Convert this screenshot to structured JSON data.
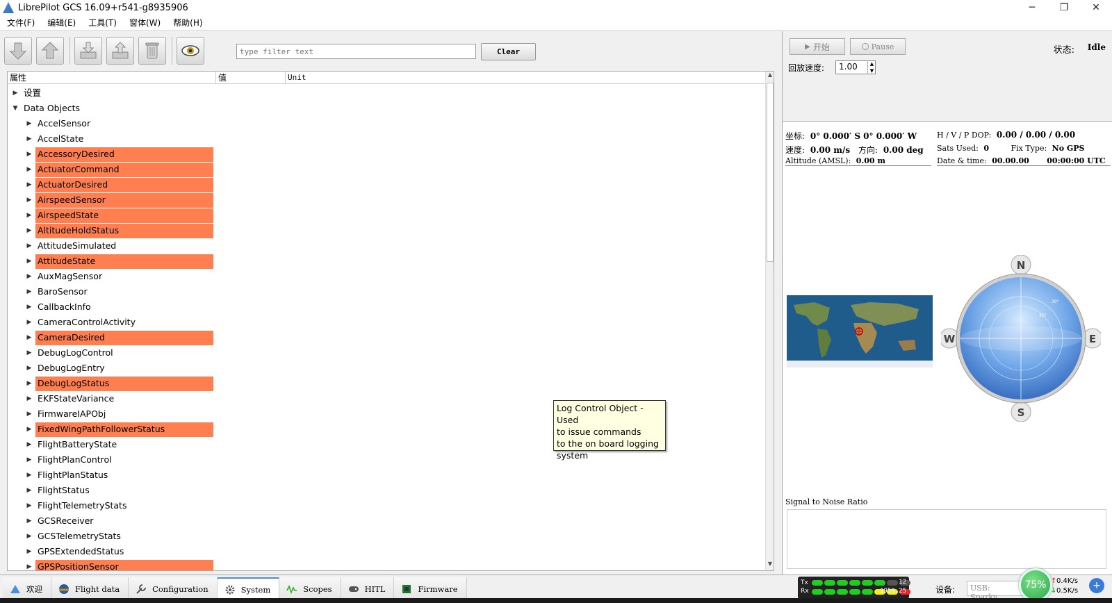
{
  "window": {
    "title": "LibrePilot GCS 16.09+r541-g8935906",
    "minimize": "─",
    "maximize": "❐",
    "close": "✕"
  },
  "menu": [
    "文件(F)",
    "编辑(E)",
    "工具(T)",
    "窗体(W)",
    "帮助(H)"
  ],
  "toolbar": {
    "filter_placeholder": "type filter text",
    "clear_label": "Clear"
  },
  "tree": {
    "headers": {
      "property": "属性",
      "value": "值",
      "unit": "Unit"
    },
    "rows": [
      {
        "label": "设置",
        "level": 0,
        "expanded": false,
        "highlight": false
      },
      {
        "label": "Data Objects",
        "level": 0,
        "expanded": true,
        "highlight": false
      },
      {
        "label": "AccelSensor",
        "level": 1,
        "highlight": false
      },
      {
        "label": "AccelState",
        "level": 1,
        "highlight": false
      },
      {
        "label": "AccessoryDesired",
        "level": 1,
        "highlight": true
      },
      {
        "label": "ActuatorCommand",
        "level": 1,
        "highlight": true
      },
      {
        "label": "ActuatorDesired",
        "level": 1,
        "highlight": true
      },
      {
        "label": "AirspeedSensor",
        "level": 1,
        "highlight": true
      },
      {
        "label": "AirspeedState",
        "level": 1,
        "highlight": true
      },
      {
        "label": "AltitudeHoldStatus",
        "level": 1,
        "highlight": true
      },
      {
        "label": "AttitudeSimulated",
        "level": 1,
        "highlight": false
      },
      {
        "label": "AttitudeState",
        "level": 1,
        "highlight": true
      },
      {
        "label": "AuxMagSensor",
        "level": 1,
        "highlight": false
      },
      {
        "label": "BaroSensor",
        "level": 1,
        "highlight": false
      },
      {
        "label": "CallbackInfo",
        "level": 1,
        "highlight": false
      },
      {
        "label": "CameraControlActivity",
        "level": 1,
        "highlight": false
      },
      {
        "label": "CameraDesired",
        "level": 1,
        "highlight": true
      },
      {
        "label": "DebugLogControl",
        "level": 1,
        "highlight": false
      },
      {
        "label": "DebugLogEntry",
        "level": 1,
        "highlight": false
      },
      {
        "label": "DebugLogStatus",
        "level": 1,
        "highlight": true
      },
      {
        "label": "EKFStateVariance",
        "level": 1,
        "highlight": false
      },
      {
        "label": "FirmwareIAPObj",
        "level": 1,
        "highlight": false
      },
      {
        "label": "FixedWingPathFollowerStatus",
        "level": 1,
        "highlight": true
      },
      {
        "label": "FlightBatteryState",
        "level": 1,
        "highlight": false
      },
      {
        "label": "FlightPlanControl",
        "level": 1,
        "highlight": false
      },
      {
        "label": "FlightPlanStatus",
        "level": 1,
        "highlight": false
      },
      {
        "label": "FlightStatus",
        "level": 1,
        "highlight": false
      },
      {
        "label": "FlightTelemetryStats",
        "level": 1,
        "highlight": false
      },
      {
        "label": "GCSReceiver",
        "level": 1,
        "highlight": false
      },
      {
        "label": "GCSTelemetryStats",
        "level": 1,
        "highlight": false
      },
      {
        "label": "GPSExtendedStatus",
        "level": 1,
        "highlight": false
      },
      {
        "label": "GPSPositionSensor",
        "level": 1,
        "highlight": true
      }
    ]
  },
  "tooltip": {
    "lines": [
      "Log Control Object - Used",
      "to issue commands",
      "to the on board logging",
      "system"
    ]
  },
  "logplayer": {
    "start_label": "开始",
    "pause_label": "Pause",
    "status_label": "状态:",
    "status_value": "Idle",
    "speed_label": "回放速度:",
    "speed_value": "1.00"
  },
  "gps": {
    "coord_label": "坐标:",
    "coord_value": "0° 0.000′ S 0° 0.000′ W",
    "speed_label": "速度:",
    "speed_value": "0.00 m/s",
    "heading_label": "方向:",
    "heading_value": "0.00 deg",
    "altitude_label": "Altitude (AMSL):",
    "altitude_value": "0.00 m",
    "dop_label": "H / V / P DOP:",
    "dop_value": "0.00 / 0.00 / 0.00",
    "sats_label": "Sats Used:",
    "sats_value": "0",
    "fix_label": "Fix Type:",
    "fix_value": "No GPS",
    "datetime_label": "Date & time:",
    "date_value": "00.00.00",
    "time_value": "00:00:00 UTC",
    "snr_label": "Signal to Noise Ratio"
  },
  "compass": {
    "n": "N",
    "s": "S",
    "e": "E",
    "w": "W",
    "ring30": "30°",
    "ring45": "45°"
  },
  "modes": [
    {
      "label": "欢迎",
      "icon": "welcome-icon",
      "active": false
    },
    {
      "label": "Flight data",
      "icon": "flight-data-icon",
      "active": false
    },
    {
      "label": "Configuration",
      "icon": "wrench-icon",
      "active": false
    },
    {
      "label": "System",
      "icon": "gear-icon",
      "active": true
    },
    {
      "label": "Scopes",
      "icon": "scope-icon",
      "active": false
    },
    {
      "label": "HITL",
      "icon": "gamepad-icon",
      "active": false
    },
    {
      "label": "Firmware",
      "icon": "chip-icon",
      "active": false
    }
  ],
  "telemetry": {
    "tx_label": "Tx",
    "rx_label": "Rx",
    "tx_value": "12",
    "rx_value": "1959.25",
    "device_label": "设备:",
    "device_value": "USB: Sparky",
    "net_percent": "75%",
    "up_speed": "0.4K/s",
    "down_speed": "0.5K/s"
  },
  "colors": {
    "highlight": "#ff7f50",
    "tooltip_bg": "#ffffe1",
    "accent": "#4a90d9"
  }
}
